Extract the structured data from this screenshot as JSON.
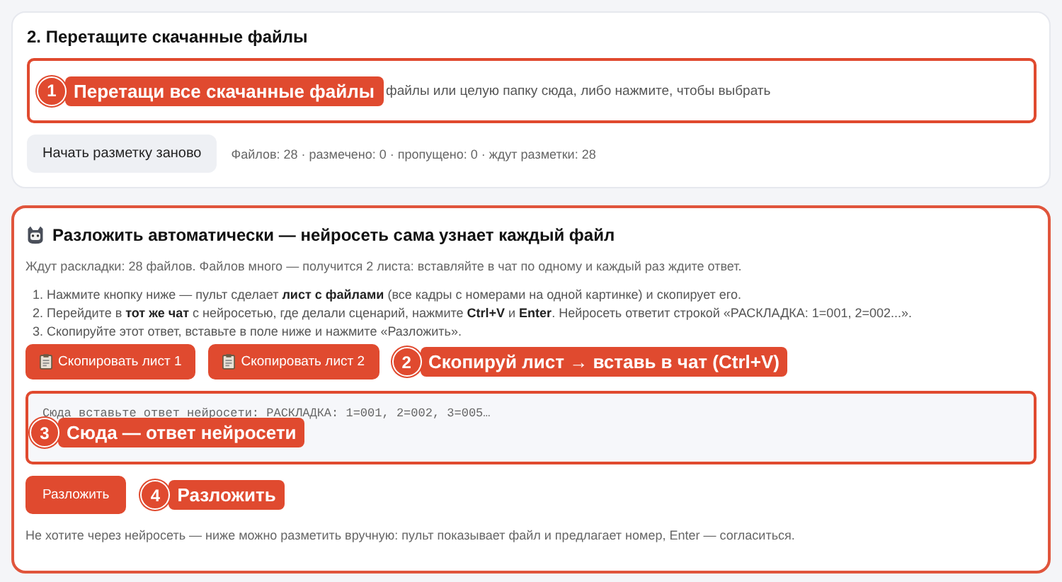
{
  "drop_section": {
    "title": "2. Перетащите скачанные файлы",
    "callout": {
      "number": "1",
      "text": "Перетащи все скачанные файлы"
    },
    "hint": "файлы или целую папку сюда, либо нажмите, чтобы выбрать",
    "reset_button": "Начать разметку заново",
    "stats": "Файлов: 28 · размечено: 0 · пропущено: 0 · ждут разметки: 28"
  },
  "auto_section": {
    "title": "Разложить автоматически — нейросеть сама узнает каждый файл",
    "intro": "Ждут раскладки: 28 файлов. Файлов много — получится 2 листа: вставляйте в чат по одному и каждый раз ждите ответ.",
    "steps": [
      "1. Нажмите кнопку ниже — пульт сделает **лист с файлами** (все кадры с номерами на одной картинке) и скопирует его.",
      "2. Перейдите в **тот же чат** с нейросетью, где делали сценарий, нажмите **Ctrl+V** и **Enter**. Нейросеть ответит строкой «РАСКЛАДКА: 1=001, 2=002...».",
      "3. Скопируйте этот ответ, вставьте в поле ниже и нажмите «Разложить»."
    ],
    "copy_buttons": [
      "Скопировать лист 1",
      "Скопировать лист 2"
    ],
    "copy_callout": {
      "number": "2",
      "text": "Скопируй лист → вставь в чат (Ctrl+V)"
    },
    "answer": {
      "placeholder": "Сюда вставьте ответ нейросети: РАСКЛАДКА: 1=001, 2=002, 3=005…",
      "callout": {
        "number": "3",
        "text": "Сюда — ответ нейросети"
      }
    },
    "apply_button": "Разложить",
    "apply_callout": {
      "number": "4",
      "text": "Разложить"
    },
    "footer": "Не хотите через нейросеть — ниже можно разметить вручную: пульт показывает файл и предлагает номер, Enter — согласиться."
  }
}
